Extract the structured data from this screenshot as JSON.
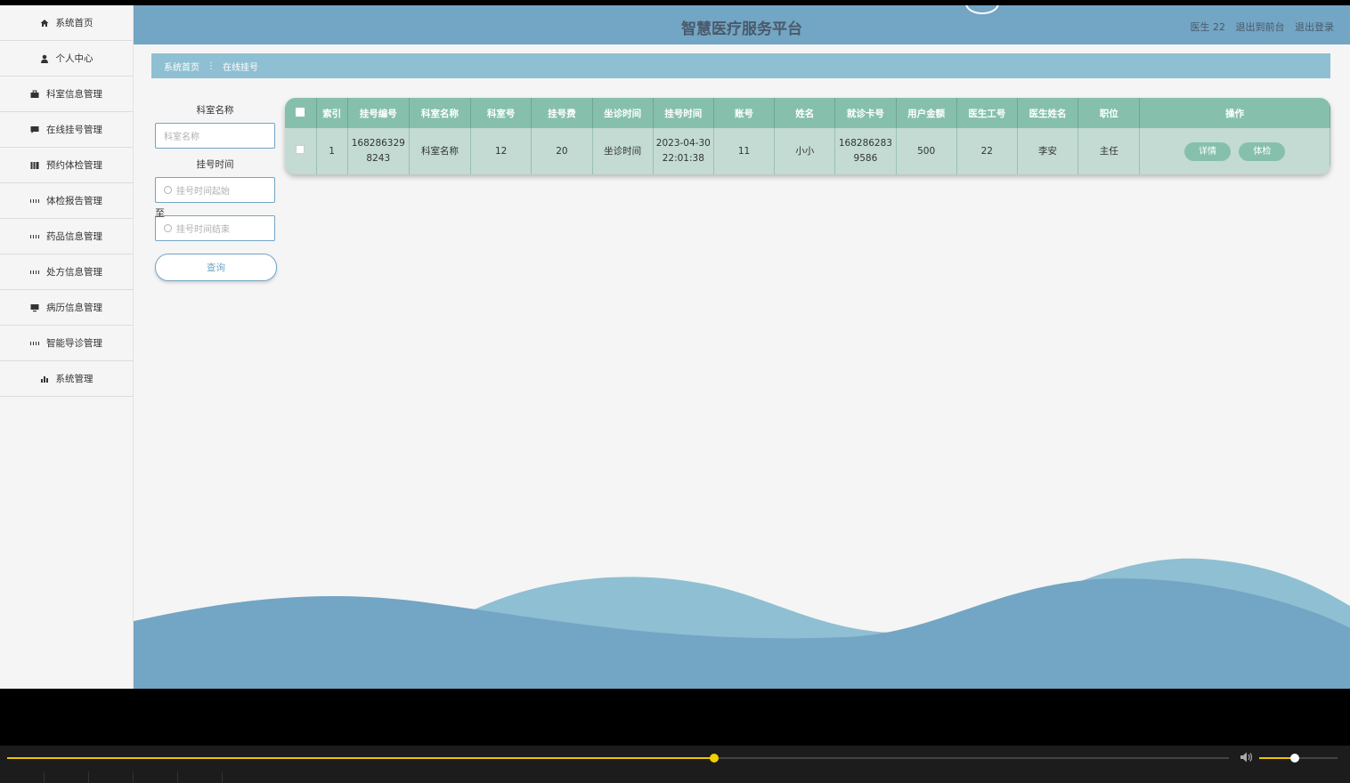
{
  "sidebar": {
    "items": [
      {
        "label": "系统首页",
        "icon": "home-icon"
      },
      {
        "label": "个人中心",
        "icon": "user-icon"
      },
      {
        "label": "科室信息管理",
        "icon": "briefcase-icon"
      },
      {
        "label": "在线挂号管理",
        "icon": "comment-icon"
      },
      {
        "label": "预约体检管理",
        "icon": "book-icon"
      },
      {
        "label": "体检报告管理",
        "icon": "grid-icon"
      },
      {
        "label": "药品信息管理",
        "icon": "grid-icon"
      },
      {
        "label": "处方信息管理",
        "icon": "grid-icon"
      },
      {
        "label": "病历信息管理",
        "icon": "monitor-icon"
      },
      {
        "label": "智能导诊管理",
        "icon": "grid-icon"
      },
      {
        "label": "系统管理",
        "icon": "bar-chart-icon"
      }
    ]
  },
  "header": {
    "title": "智慧医疗服务平台",
    "user": "医生 22",
    "back_to_front": "退出到前台",
    "logout": "退出登录"
  },
  "breadcrumb": {
    "home": "系统首页",
    "separator": "⋮",
    "current": "在线挂号"
  },
  "search": {
    "dept_label": "科室名称",
    "dept_placeholder": "科室名称",
    "time_label": "挂号时间",
    "start_placeholder": "挂号时间起始",
    "to_text": "至",
    "end_placeholder": "挂号时间结束",
    "query_button": "查询"
  },
  "table": {
    "headers": [
      "索引",
      "挂号编号",
      "科室名称",
      "科室号",
      "挂号费",
      "坐诊时间",
      "挂号时间",
      "账号",
      "姓名",
      "就诊卡号",
      "用户金额",
      "医生工号",
      "医生姓名",
      "职位",
      "操作"
    ],
    "rows": [
      {
        "index": "1",
        "reg_no": "1682863298243",
        "dept_name": "科室名称",
        "dept_no": "12",
        "fee": "20",
        "clinic_time": "坐诊时间",
        "reg_time": "2023-04-30 22:01:38",
        "account": "11",
        "name": "小小",
        "card_no": "1682862839586",
        "balance": "500",
        "doctor_id": "22",
        "doctor_name": "李安",
        "position": "主任",
        "detail_button": "详情",
        "exam_button": "体检"
      }
    ]
  },
  "player": {
    "progress_fraction": 0.579,
    "volume_fraction": 0.45
  },
  "colors": {
    "header_bg": "#73a5c4",
    "breadcrumb_bg": "#8fbfd2",
    "table_header_bg": "#86c0ad",
    "table_row_bg": "#c3dbd3",
    "wave_dark": "#73a5c4",
    "wave_light": "#8fbfd2",
    "progress": "#f0c400"
  }
}
